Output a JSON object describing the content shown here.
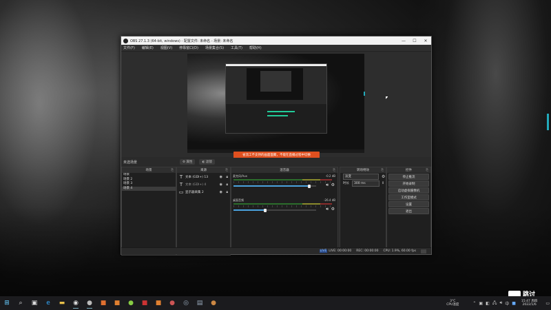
{
  "window": {
    "title": "OBS 27.1.3 (64-bit, windows) - 配置文件: 未命名 - 场景: 未命名",
    "controls": [
      "—",
      "☐",
      "✕"
    ]
  },
  "menu": [
    "文件(F)",
    "编辑(E)",
    "视图(V)",
    "停靠窗口(D)",
    "场景集合(S)",
    "工具(T)",
    "帮助(H)"
  ],
  "preview": {
    "warning": "省流工不支持的画面面聚，不能在直播过程中切换"
  },
  "scenebar": {
    "current": "未选场景",
    "properties": "属性",
    "filters": "滤镜"
  },
  "scenes": {
    "header": "场景",
    "items": [
      "场景",
      "场景 2",
      "场景 3",
      "场景 4"
    ]
  },
  "sources": {
    "header": "来源",
    "items": [
      {
        "icon": "T",
        "label": "文本 (GDI+) 13"
      },
      {
        "icon": "T",
        "label": "文本 (GDI+) 4"
      },
      {
        "icon": "▭",
        "label": "显示器采集 2"
      }
    ]
  },
  "mixer": {
    "header": "混音器",
    "tracks": [
      {
        "name": "麦克风/Aux",
        "db": "-0.2 dB",
        "volume": 0.92
      },
      {
        "name": "桌面音频",
        "db": "-26.4 dB",
        "volume": 0.38
      }
    ]
  },
  "transitions": {
    "header": "转场特效",
    "type": "淡变",
    "duration_label": "时长",
    "duration": "300 ms"
  },
  "controls": {
    "header": "控件",
    "buttons": [
      "停止推流",
      "开始录制",
      "启动虚拟摄像机",
      "工作室模式",
      "设置",
      "退出"
    ]
  },
  "status": {
    "live_badge": "LIVE",
    "live": "LIVE: 00:00:00",
    "rec": "REC: 00:00:00",
    "cpu": "CPU: 1.9%, 60.00 fps"
  },
  "watermark": "跳讨",
  "taskbar": {
    "weather_temp": "3°C",
    "weather_text": "CPU温度",
    "time": "15:47 周四",
    "date": "2022/1/6"
  }
}
